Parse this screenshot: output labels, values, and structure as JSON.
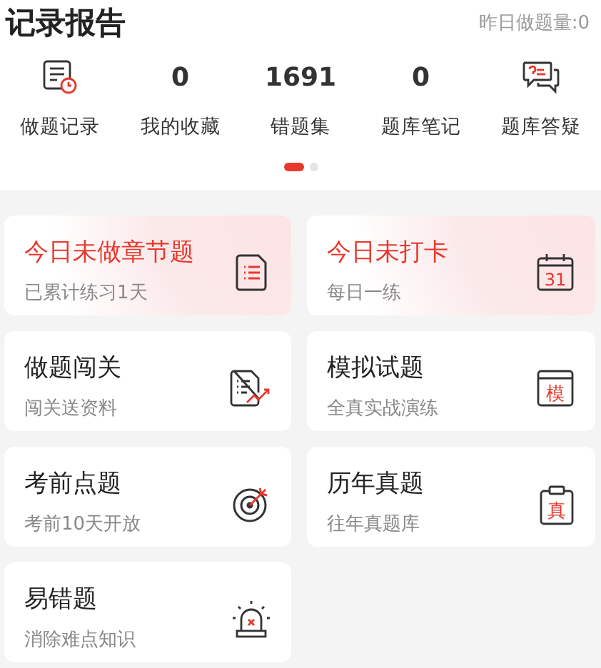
{
  "header": {
    "title": "记录报告",
    "yesterday": "昨日做题量:0"
  },
  "stats": [
    {
      "kind": "icon",
      "label": "做题记录"
    },
    {
      "kind": "count",
      "value": "0",
      "label": "我的收藏"
    },
    {
      "kind": "count",
      "value": "1691",
      "label": "错题集"
    },
    {
      "kind": "count",
      "value": "0",
      "label": "题库笔记"
    },
    {
      "kind": "icon",
      "label": "题库答疑"
    }
  ],
  "pager": [
    {
      "selected": true
    },
    {
      "selected": false
    }
  ],
  "cards": [
    {
      "title": "今日未做章节题",
      "subtitle": "已累计练习1天",
      "highlighted": true
    },
    {
      "title": "今日未打卡",
      "subtitle": "每日一练",
      "highlighted": true,
      "icon_text": "31"
    },
    {
      "title": "做题闯关",
      "subtitle": "闯关送资料",
      "highlighted": false
    },
    {
      "title": "模拟试题",
      "subtitle": "全真实战演练",
      "highlighted": false,
      "icon_text": "模"
    },
    {
      "title": "考前点题",
      "subtitle": "考前10天开放",
      "highlighted": false
    },
    {
      "title": "历年真题",
      "subtitle": "往年真题库",
      "highlighted": false,
      "icon_text": "真"
    },
    {
      "title": "易错题",
      "subtitle": "消除难点知识",
      "highlighted": false
    }
  ]
}
